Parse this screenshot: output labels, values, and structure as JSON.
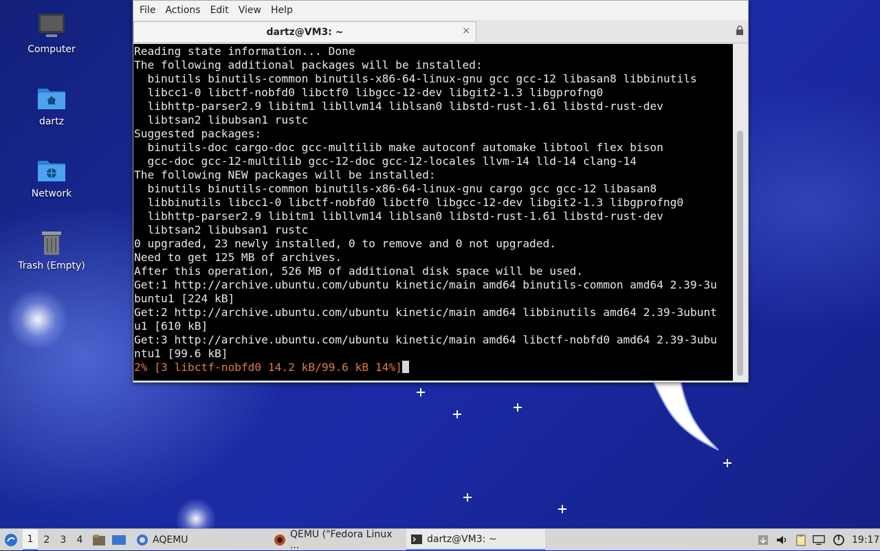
{
  "desktop": {
    "icons": [
      {
        "label": "Computer",
        "icon": "computer-icon"
      },
      {
        "label": "dartz",
        "icon": "home-folder-icon"
      },
      {
        "label": "Network",
        "icon": "network-folder-icon"
      },
      {
        "label": "Trash (Empty)",
        "icon": "trash-icon"
      }
    ]
  },
  "window": {
    "menu": [
      "File",
      "Actions",
      "Edit",
      "View",
      "Help"
    ],
    "tab_title": "dartz@VM3: ~",
    "tab_close": "×"
  },
  "terminal": {
    "lines": [
      "Reading state information... Done",
      "The following additional packages will be installed:",
      "  binutils binutils-common binutils-x86-64-linux-gnu gcc gcc-12 libasan8 libbinutils",
      "  libcc1-0 libctf-nobfd0 libctf0 libgcc-12-dev libgit2-1.3 libgprofng0",
      "  libhttp-parser2.9 libitm1 libllvm14 liblsan0 libstd-rust-1.61 libstd-rust-dev",
      "  libtsan2 libubsan1 rustc",
      "Suggested packages:",
      "  binutils-doc cargo-doc gcc-multilib make autoconf automake libtool flex bison",
      "  gcc-doc gcc-12-multilib gcc-12-doc gcc-12-locales llvm-14 lld-14 clang-14",
      "The following NEW packages will be installed:",
      "  binutils binutils-common binutils-x86-64-linux-gnu cargo gcc gcc-12 libasan8",
      "  libbinutils libcc1-0 libctf-nobfd0 libctf0 libgcc-12-dev libgit2-1.3 libgprofng0",
      "  libhttp-parser2.9 libitm1 libllvm14 liblsan0 libstd-rust-1.61 libstd-rust-dev",
      "  libtsan2 libubsan1 rustc",
      "0 upgraded, 23 newly installed, 0 to remove and 0 not upgraded.",
      "Need to get 125 MB of archives.",
      "After this operation, 526 MB of additional disk space will be used.",
      "Get:1 http://archive.ubuntu.com/ubuntu kinetic/main amd64 binutils-common amd64 2.39-3u",
      "buntu1 [224 kB]",
      "Get:2 http://archive.ubuntu.com/ubuntu kinetic/main amd64 libbinutils amd64 2.39-3ubunt",
      "u1 [610 kB]",
      "Get:3 http://archive.ubuntu.com/ubuntu kinetic/main amd64 libctf-nobfd0 amd64 2.39-3ubu",
      "ntu1 [99.6 kB]"
    ],
    "progress_line": "2% [3 libctf-nobfd0 14.2 kB/99.6 kB 14%]"
  },
  "panel": {
    "workspaces": [
      "1",
      "2",
      "3",
      "4"
    ],
    "active_workspace": "1",
    "tasks": [
      {
        "label": "AQEMU",
        "icon": "aqemu-icon"
      },
      {
        "label": "QEMU (\"Fedora Linux ...",
        "icon": "qemu-icon"
      },
      {
        "label": "dartz@VM3: ~",
        "icon": "terminal-icon"
      }
    ],
    "clock": "19:17"
  }
}
